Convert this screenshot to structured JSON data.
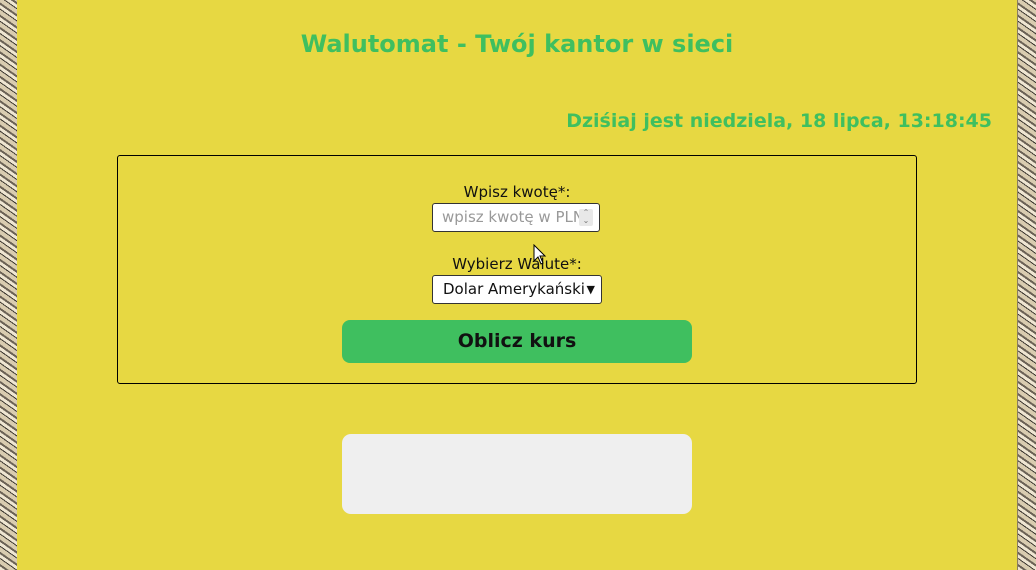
{
  "header": {
    "title": "Walutomat - Twój kantor w sieci",
    "date_text": "Dziśiaj jest niedziela, 18 lipca, 13:18:45"
  },
  "form": {
    "amount_label": "Wpisz kwotę*:",
    "amount_placeholder": "wpisz kwotę w PLN",
    "currency_label": "Wybierz Walute*:",
    "currency_selected": "Dolar Amerykański",
    "calculate_label": "Oblicz kurs"
  },
  "result": {
    "text": ""
  },
  "colors": {
    "page_background": "#e7d842",
    "accent_green": "#3fbf5f",
    "result_background": "#efefef"
  },
  "icons": {
    "spinner": "number-spinner-icon",
    "select_arrow": "chevron-down-icon",
    "cursor": "mouse-pointer-icon"
  }
}
